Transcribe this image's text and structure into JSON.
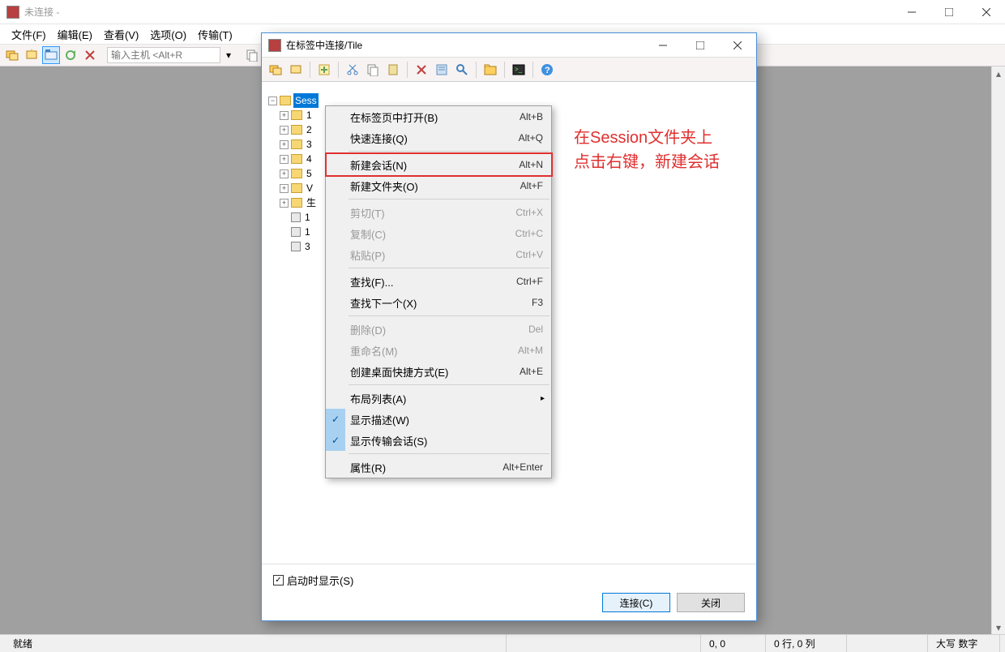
{
  "main": {
    "title": "未连接 -",
    "menubar": [
      "文件(F)",
      "编辑(E)",
      "查看(V)",
      "选项(O)",
      "传输(T)"
    ],
    "host_placeholder": "输入主机 <Alt+R"
  },
  "dialog": {
    "title": "在标签中连接/Tile",
    "tree": {
      "root": "Sess",
      "items": [
        "1",
        "2",
        "3",
        "4",
        "5",
        "V",
        "生"
      ],
      "sessions": [
        "1",
        "1",
        "3"
      ]
    },
    "footer": {
      "show_on_startup": "启动时显示(S)",
      "connect": "连接(C)",
      "close": "关闭"
    }
  },
  "context_menu": {
    "items": [
      {
        "label": "在标签页中打开(B)",
        "shortcut": "Alt+B",
        "type": "item"
      },
      {
        "label": "快速连接(Q)",
        "shortcut": "Alt+Q",
        "type": "item"
      },
      {
        "type": "sep"
      },
      {
        "label": "新建会话(N)",
        "shortcut": "Alt+N",
        "type": "item",
        "highlight": true
      },
      {
        "label": "新建文件夹(O)",
        "shortcut": "Alt+F",
        "type": "item"
      },
      {
        "type": "sep"
      },
      {
        "label": "剪切(T)",
        "shortcut": "Ctrl+X",
        "type": "item",
        "disabled": true
      },
      {
        "label": "复制(C)",
        "shortcut": "Ctrl+C",
        "type": "item",
        "disabled": true
      },
      {
        "label": "粘贴(P)",
        "shortcut": "Ctrl+V",
        "type": "item",
        "disabled": true
      },
      {
        "type": "sep"
      },
      {
        "label": "查找(F)...",
        "shortcut": "Ctrl+F",
        "type": "item"
      },
      {
        "label": "查找下一个(X)",
        "shortcut": "F3",
        "type": "item"
      },
      {
        "type": "sep"
      },
      {
        "label": "删除(D)",
        "shortcut": "Del",
        "type": "item",
        "disabled": true
      },
      {
        "label": "重命名(M)",
        "shortcut": "Alt+M",
        "type": "item",
        "disabled": true
      },
      {
        "label": "创建桌面快捷方式(E)",
        "shortcut": "Alt+E",
        "type": "item"
      },
      {
        "type": "sep"
      },
      {
        "label": "布局列表(A)",
        "shortcut": "",
        "type": "submenu"
      },
      {
        "label": "显示描述(W)",
        "shortcut": "",
        "type": "item",
        "checked": true
      },
      {
        "label": "显示传输会话(S)",
        "shortcut": "",
        "type": "item",
        "checked": true
      },
      {
        "type": "sep"
      },
      {
        "label": "属性(R)",
        "shortcut": "Alt+Enter",
        "type": "item"
      }
    ]
  },
  "annotation": {
    "line1": "在Session文件夹上",
    "line2": "点击右键，新建会话"
  },
  "statusbar": {
    "ready": "就绪",
    "pos": "0, 0",
    "dim": "0 行, 0 列",
    "caps": "大写 数字"
  }
}
